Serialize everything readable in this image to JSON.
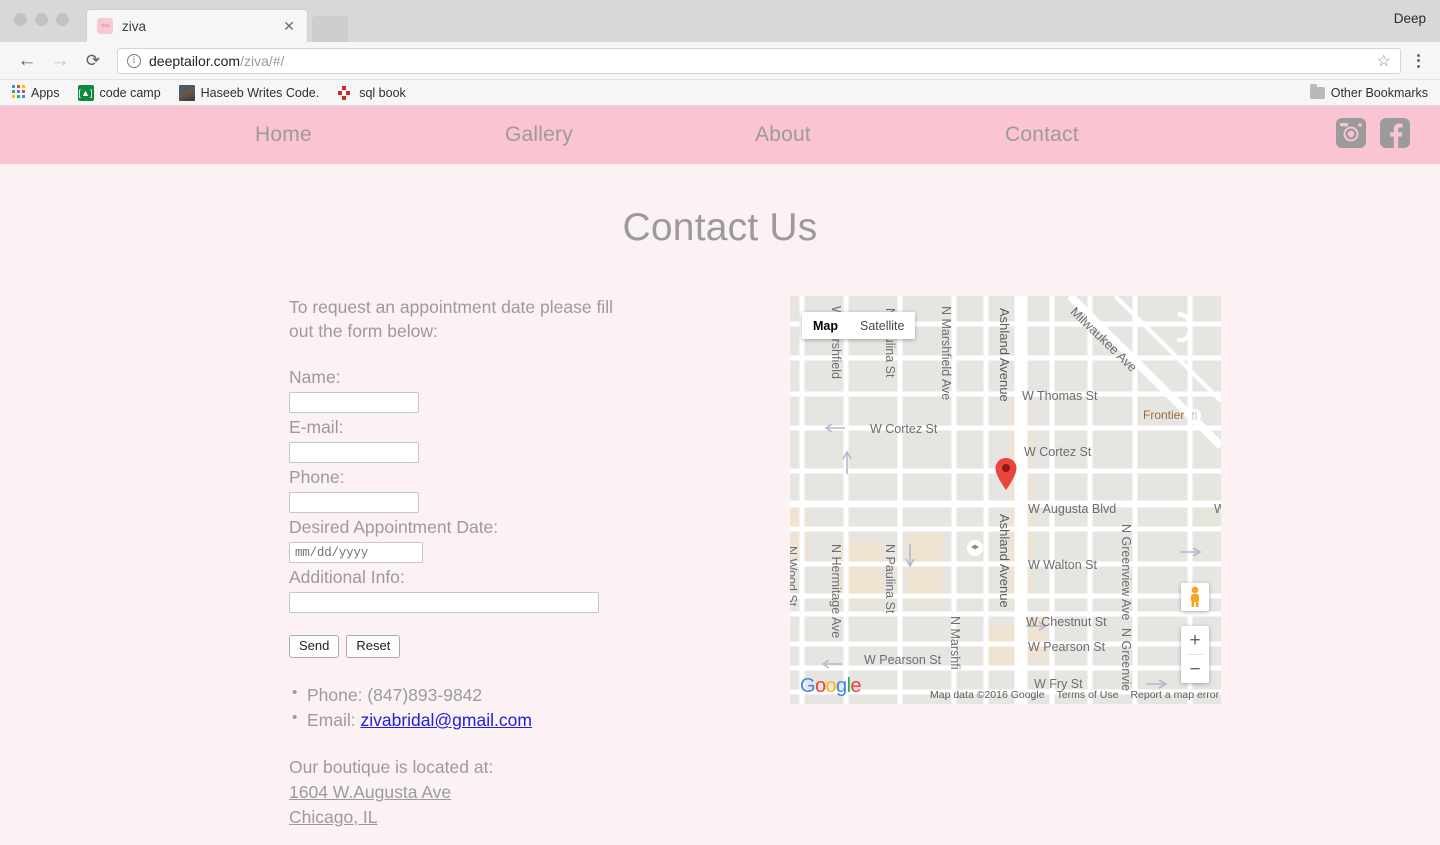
{
  "browser": {
    "tab": {
      "title": "ziva",
      "favicon_label": "ziva",
      "close_label": "✕"
    },
    "profile_name": "Deep",
    "nav": {
      "back": "←",
      "forward": "→",
      "reload": "⟳"
    },
    "omnibox": {
      "security_icon": "info-icon",
      "url_domain": "deeptailor.com",
      "url_path": "/ziva/#/",
      "star": "☆",
      "menu": "kebab-menu-icon"
    },
    "bookmarks": [
      {
        "label": "Apps",
        "icon": "apps-grid-icon"
      },
      {
        "label": "code camp",
        "icon": "freecodecamp-icon"
      },
      {
        "label": "Haseeb Writes Code.",
        "icon": "avatar-icon"
      },
      {
        "label": "sql book",
        "icon": "sql-icon"
      }
    ],
    "other_bookmarks": {
      "label": "Other Bookmarks",
      "icon": "folder-icon"
    }
  },
  "site": {
    "nav_items": [
      {
        "label": "Home"
      },
      {
        "label": "Gallery"
      },
      {
        "label": "About"
      },
      {
        "label": "Contact"
      }
    ],
    "socials": [
      {
        "name": "instagram-icon"
      },
      {
        "name": "facebook-icon"
      }
    ],
    "page_title": "Contact Us",
    "colors": {
      "nav_pink": "#fbc4d2",
      "page_background": "#fcf2f3",
      "text_gray": "#9b9b9b",
      "link_blue": "#2020dd",
      "marker_red": "#e8453c"
    }
  },
  "form": {
    "intro": "To request an appointment date please fill out the form below:",
    "fields": [
      {
        "label": "Name:",
        "value": "",
        "placeholder": "",
        "type": "text"
      },
      {
        "label": "E-mail:",
        "value": "",
        "placeholder": "",
        "type": "text"
      },
      {
        "label": "Phone:",
        "value": "",
        "placeholder": "",
        "type": "text"
      },
      {
        "label": "Desired Appointment Date:",
        "value": "",
        "placeholder": "mm/dd/yyyy",
        "type": "date"
      },
      {
        "label": "Additional Info:",
        "value": "",
        "placeholder": "",
        "type": "text"
      }
    ],
    "buttons": [
      {
        "label": "Send"
      },
      {
        "label": "Reset"
      }
    ]
  },
  "contact": {
    "items": [
      {
        "prefix": "Phone: ",
        "value": "(847)893-9842",
        "is_link": false
      },
      {
        "prefix": "Email: ",
        "value": "zivabridal@gmail.com",
        "is_link": true
      }
    ],
    "boutique_heading": "Our boutique is located at:",
    "address_line1": "1604 W.Augusta Ave",
    "address_line2": "Chicago, IL"
  },
  "map": {
    "toggle": [
      {
        "label": "Map",
        "active": true
      },
      {
        "label": "Satellite",
        "active": false
      }
    ],
    "pegman_label": "street-view-pegman",
    "zoom_in": "+",
    "zoom_out": "−",
    "logo_letters": [
      "G",
      "o",
      "o",
      "g",
      "l",
      "e"
    ],
    "attribution": [
      {
        "label": "Map data ©2016 Google"
      },
      {
        "label": "Terms of Use"
      },
      {
        "label": "Report a map error"
      }
    ],
    "marker_label": "location-marker",
    "poi": [
      {
        "label": "Frontier",
        "glyph": "🍴"
      }
    ],
    "streets": [
      {
        "label": "N Wood St"
      },
      {
        "label": "N Hermitage Ave"
      },
      {
        "label": "N Paulina St"
      },
      {
        "label": "N Marshfield Ave"
      },
      {
        "label": "Ashland Avenue"
      },
      {
        "label": "N Greenview Ave"
      },
      {
        "label": "Milwaukee Ave"
      },
      {
        "label": "W Thomas St"
      },
      {
        "label": "W Cortez St"
      },
      {
        "label": "W Augusta Blvd"
      },
      {
        "label": "W Walton St"
      },
      {
        "label": "W Chestnut St"
      },
      {
        "label": "W Pearson St"
      },
      {
        "label": "W Fry St"
      },
      {
        "label": "W Marshfield"
      },
      {
        "label": "N Marshfi"
      },
      {
        "label": "N Greenvie"
      },
      {
        "label": "W"
      }
    ]
  }
}
